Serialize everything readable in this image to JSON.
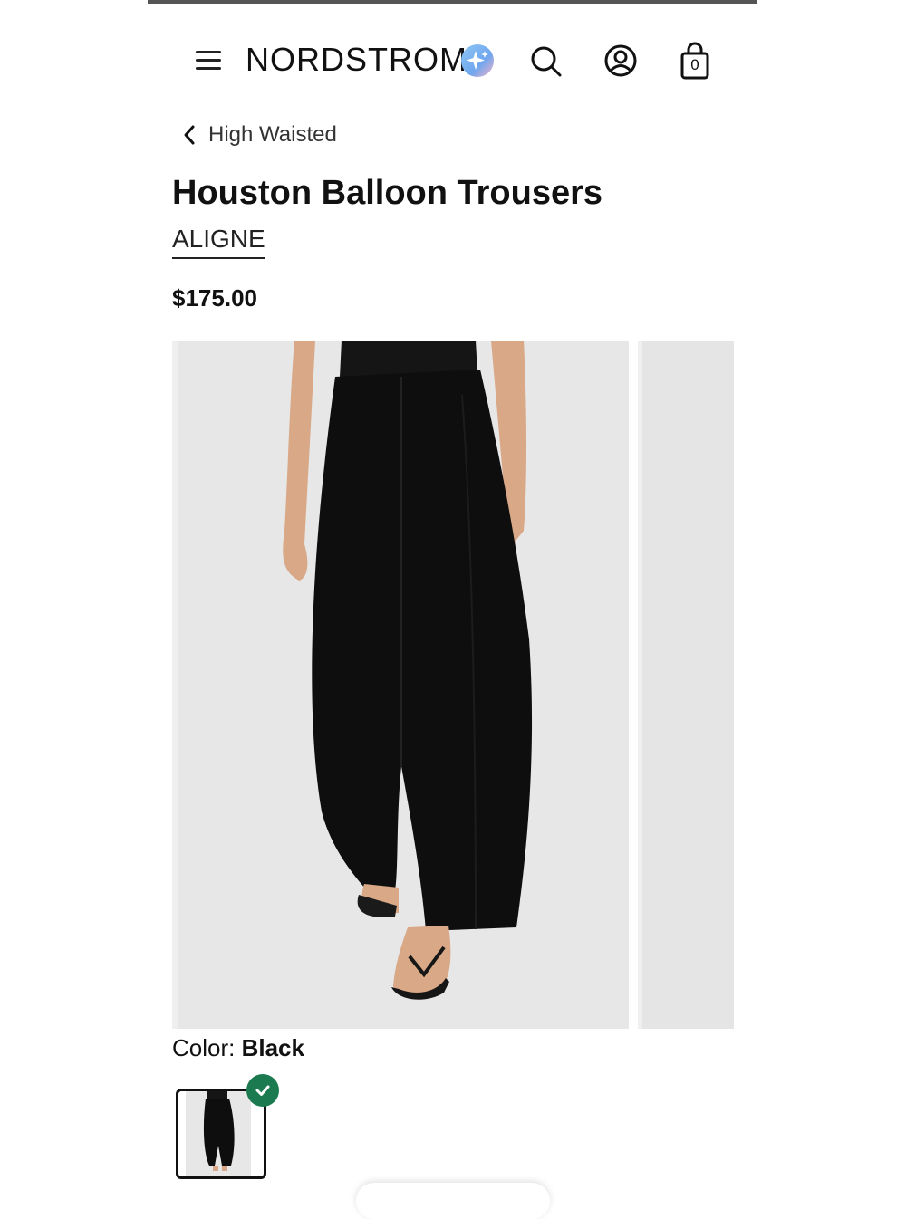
{
  "header": {
    "logo_text": "NORDSTROM",
    "bag_count": "0",
    "icons": [
      "menu-icon",
      "sparkle-icon",
      "search-icon",
      "account-icon",
      "bag-icon"
    ]
  },
  "breadcrumb": {
    "label": "High Waisted"
  },
  "product": {
    "title": "Houston Balloon Trousers",
    "brand": "ALIGNE",
    "price": "$175.00"
  },
  "color": {
    "label": "Color:",
    "selected": "Black"
  },
  "colors": {
    "accent_check": "#1b7a4f",
    "image_bg": "#e7e7e7"
  }
}
